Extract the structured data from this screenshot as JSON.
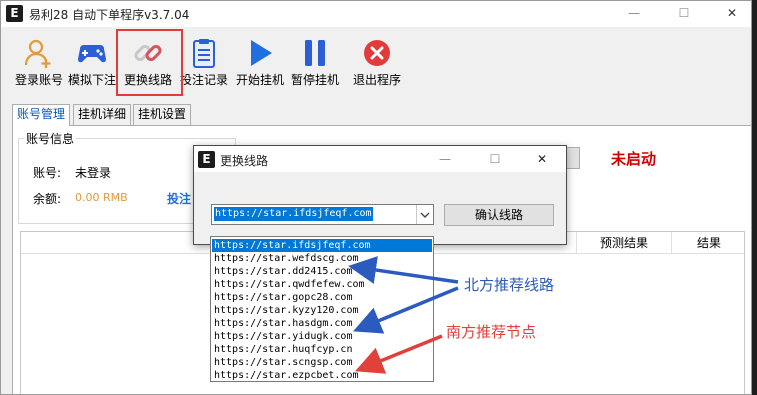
{
  "window": {
    "logo": "E",
    "title": "易利28 自动下单程序v3.7.04",
    "min_glyph": "—",
    "max_glyph": "☐",
    "close_glyph": "✕"
  },
  "toolbar": {
    "items": [
      {
        "label": "登录账号",
        "icon": "user-add-icon"
      },
      {
        "label": "模拟下注",
        "icon": "gamepad-icon"
      },
      {
        "label": "更换线路",
        "icon": "link-icon"
      },
      {
        "label": "投注记录",
        "icon": "clipboard-icon"
      },
      {
        "label": "开始挂机",
        "icon": "play-icon"
      },
      {
        "label": "暂停挂机",
        "icon": "pause-icon"
      },
      {
        "label": "退出程序",
        "icon": "exit-icon"
      }
    ],
    "highlight_color": "#e23b3b"
  },
  "tabs": [
    "账号管理",
    "挂机详细",
    "挂机设置"
  ],
  "account": {
    "group_title": "账号信息",
    "account_label": "账号:",
    "account_value": "未登录",
    "balance_label": "余额:",
    "balance_value": "0.00 RMB",
    "bet_link": "投注"
  },
  "status": {
    "text": "未启动",
    "color": "#d10000"
  },
  "table": {
    "headers": [
      "预测结果",
      "结果"
    ]
  },
  "dialog": {
    "logo": "E",
    "title": "更换线路",
    "combo_value": "https://star.ifdsjfeqf.com",
    "confirm_label": "确认线路",
    "options": [
      "https://star.ifdsjfeqf.com",
      "https://star.wefdscg.com",
      "https://star.dd2415.com",
      "https://star.qwdfefew.com",
      "https://star.gopc28.com",
      "https://star.kyzy120.com",
      "https://star.hasdgm.com",
      "https://star.yidugk.com",
      "https://star.huqfcyp.cn",
      "https://star.scngsp.com",
      "https://star.ezpcbet.com"
    ],
    "selected_index": 0
  },
  "annotations": {
    "north": {
      "text": "北方推荐线路",
      "color": "#2b5bbf"
    },
    "south": {
      "text": "南方推荐节点",
      "color": "#e0413a"
    }
  }
}
